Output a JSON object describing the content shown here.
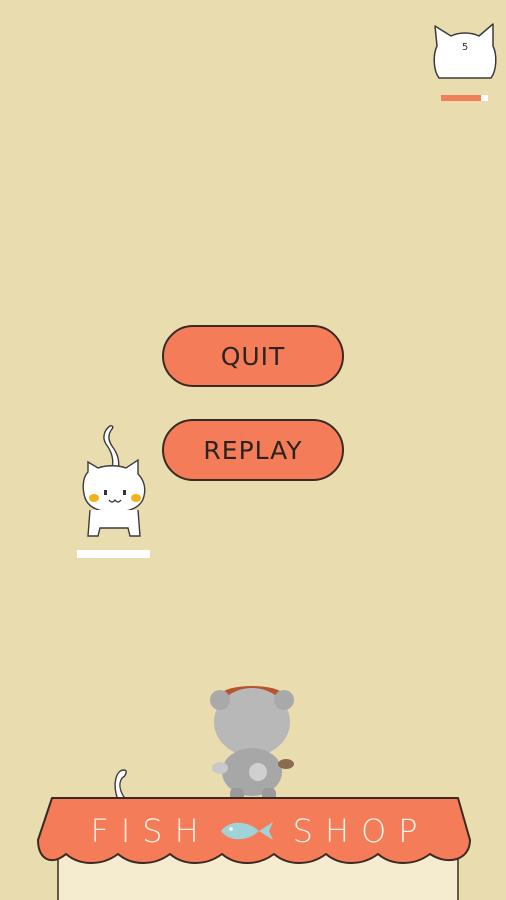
{
  "hud": {
    "cat_count": "5",
    "health_fraction": 0.85,
    "icons": [
      "cat-counter-icon"
    ]
  },
  "menu": {
    "quit_label": "QUIT",
    "replay_label": "REPLAY"
  },
  "shop": {
    "word1": "FISH",
    "word2": "SHOP",
    "icons": [
      "fish-icon"
    ]
  },
  "colors": {
    "background": "#e9ddb0",
    "accent": "#f47c58",
    "outline": "#3b2a24"
  }
}
